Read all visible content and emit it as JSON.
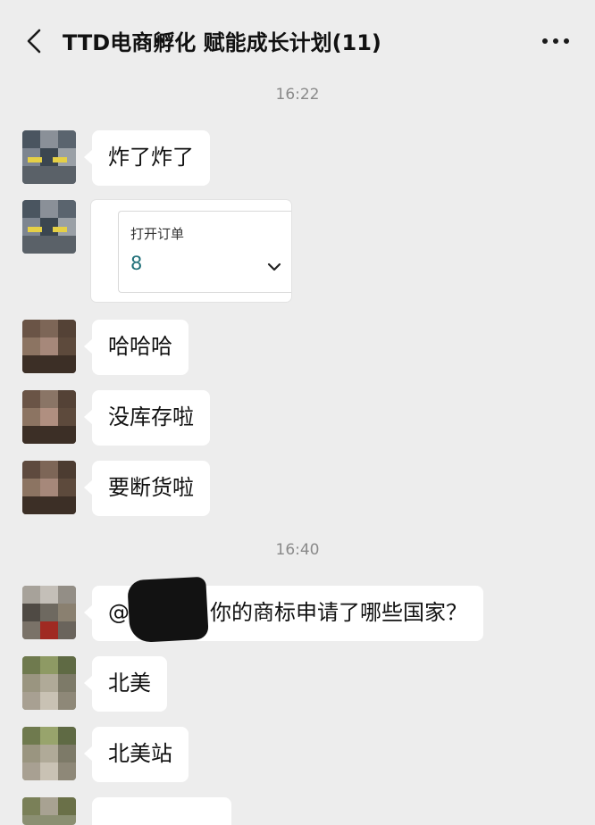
{
  "header": {
    "title": "TTD电商孵化 赋能成长计划(11)",
    "back_icon": "chevron-left-icon",
    "more_icon": "more-dots-icon"
  },
  "timestamps": [
    "16:22",
    "16:40"
  ],
  "messages": [
    {
      "text": "炸了炸了"
    },
    {
      "card": {
        "label": "打开订单",
        "value": "8"
      }
    },
    {
      "text": "哈哈哈"
    },
    {
      "text": "没库存啦"
    },
    {
      "text": "要断货啦"
    },
    {
      "mention": "@",
      "text": "你的商标申请了哪些国家？"
    },
    {
      "text": "北美"
    },
    {
      "text": "北美站"
    }
  ]
}
